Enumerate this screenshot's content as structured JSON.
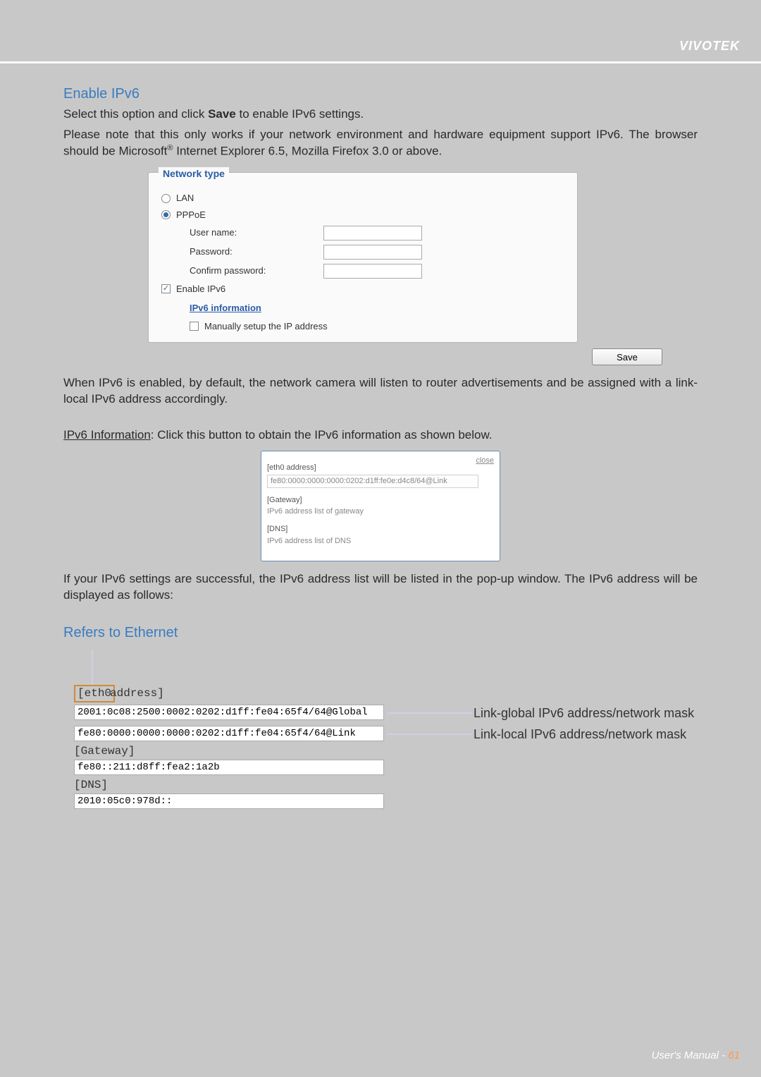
{
  "header": {
    "brand": "VIVOTEK"
  },
  "section": {
    "title": "Enable IPv6",
    "intro1_a": "Select this option and click ",
    "intro1_b": "Save",
    "intro1_c": " to enable IPv6 settings.",
    "intro2": "Please note that this only works if your network environment and hardware equipment support IPv6. The browser should be Microsoft",
    "intro2_sup": "®",
    "intro2_tail": " Internet Explorer 6.5, Mozilla Firefox 3.0 or above."
  },
  "panel": {
    "legend": "Network type",
    "lan_label": "LAN",
    "pppoe_label": "PPPoE",
    "username_label": "User name:",
    "username_value": "",
    "password_label": "Password:",
    "password_value": "",
    "confirm_label": "Confirm password:",
    "confirm_value": "",
    "enable_ipv6_label": "Enable IPv6",
    "ipv6_info_link": "IPv6 information",
    "manual_label": "Manually setup the IP address",
    "save_label": "Save"
  },
  "para_after_panel": "When IPv6 is enabled, by default, the network camera will listen to router advertisements and be assigned with a link-local IPv6 address accordingly.",
  "ipv6_info_para_a": "IPv6 Information",
  "ipv6_info_para_b": ": Click this button to obtain the IPv6 information as shown below.",
  "popup": {
    "close_label": "close",
    "eth0_label": "[eth0 address]",
    "eth0_value": "fe80:0000:0000:0000:0202:d1ff:fe0e:d4c8/64@Link",
    "gateway_label": "[Gateway]",
    "gateway_caption": "IPv6 address list of gateway",
    "dns_label": "[DNS]",
    "dns_caption": "IPv6 address list of DNS"
  },
  "para_after_popup": "If your IPv6 settings are successful, the IPv6 address list will be listed in the pop-up window. The IPv6 address will be displayed as follows:",
  "refers_title": "Refers to Ethernet",
  "diagram": {
    "eth0_box": "eth0",
    "eth0_tail": " address]",
    "global_addr": "2001:0c08:2500:0002:0202:d1ff:fe04:65f4/64@Global",
    "link_addr": "fe80:0000:0000:0000:0202:d1ff:fe04:65f4/64@Link",
    "gateway_label": "[Gateway]",
    "gateway_value": "fe80::211:d8ff:fea2:1a2b",
    "dns_label": "[DNS]",
    "dns_value": "2010:05c0:978d::",
    "global_note": "Link-global IPv6 address/network mask",
    "link_note": "Link-local IPv6 address/network mask"
  },
  "footer": {
    "text": "User's Manual - ",
    "page": "61"
  }
}
